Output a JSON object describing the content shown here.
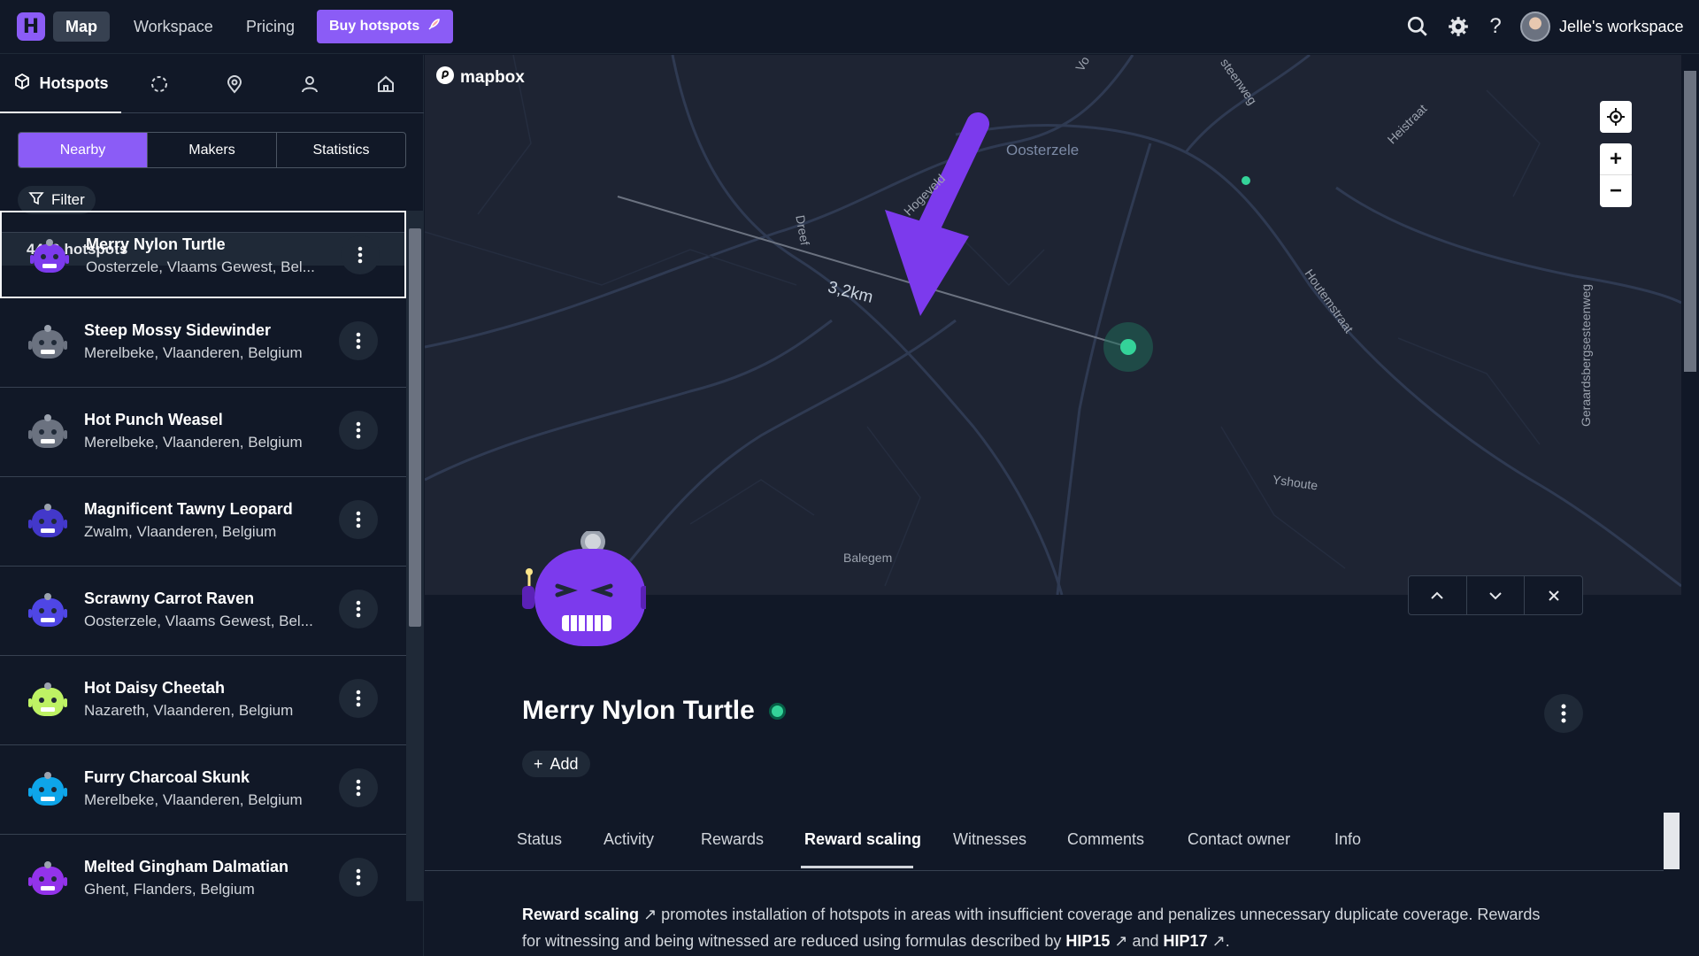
{
  "topbar": {
    "logo_letter": "H",
    "nav": [
      "Map",
      "Workspace",
      "Pricing"
    ],
    "buy_label": "Buy hotspots",
    "workspace_label": "Jelle's workspace",
    "icons": [
      "search-icon",
      "gear-icon",
      "help-icon"
    ]
  },
  "sidebar": {
    "active_tab_label": "Hotspots",
    "tab_icons": [
      "cube-icon",
      "region-icon",
      "location-pin-icon",
      "user-icon",
      "home-icon"
    ],
    "segments": [
      "Nearby",
      "Makers",
      "Statistics"
    ],
    "selected_segment": "Nearby",
    "filter_label": "Filter",
    "count_label": "4490 hotspots",
    "items": [
      {
        "name": "Merry Nylon Turtle",
        "location": "Oosterzele, Vlaams Gewest, Bel...",
        "color": "#7c3aed"
      },
      {
        "name": "Steep Mossy Sidewinder",
        "location": "Merelbeke, Vlaanderen, Belgium",
        "color": "#6b7280"
      },
      {
        "name": "Hot Punch Weasel",
        "location": "Merelbeke, Vlaanderen, Belgium",
        "color": "#6b7280"
      },
      {
        "name": "Magnificent Tawny Leopard",
        "location": "Zwalm, Vlaanderen, Belgium",
        "color": "#4338ca"
      },
      {
        "name": "Scrawny Carrot Raven",
        "location": "Oosterzele, Vlaams Gewest, Bel...",
        "color": "#4f46e5"
      },
      {
        "name": "Hot Daisy Cheetah",
        "location": "Nazareth, Vlaanderen, Belgium",
        "color": "#bef264"
      },
      {
        "name": "Furry Charcoal Skunk",
        "location": "Merelbeke, Vlaanderen, Belgium",
        "color": "#0ea5e9"
      },
      {
        "name": "Melted Gingham Dalmatian",
        "location": "Ghent, Flanders, Belgium",
        "color": "#9333ea"
      }
    ]
  },
  "map": {
    "attribution": "mapbox",
    "distance_label": "3,2km",
    "places": [
      "Oosterzele",
      "Balegem",
      "Yshoute",
      "Houtemstraat",
      "Geraardsbergsesteenweg",
      "Dreef",
      "Hogeveld",
      "Heistraat",
      "steenweg",
      "Vo"
    ],
    "controls": [
      "locate-icon",
      "zoom-in-icon",
      "zoom-out-icon"
    ]
  },
  "detail": {
    "title": "Merry Nylon Turtle",
    "add_label": "Add",
    "tabs": [
      "Status",
      "Activity",
      "Rewards",
      "Reward scaling",
      "Witnesses",
      "Comments",
      "Contact owner",
      "Info"
    ],
    "active_tab": "Reward scaling",
    "desc_link1": "Reward scaling",
    "desc_text1": " promotes installation of hotspots in areas with insufficient coverage and penalizes unnecessary duplicate coverage. Rewards for witnessing and being witnessed are reduced using formulas described by ",
    "desc_link2": "HIP15",
    "desc_text2": " and ",
    "desc_link3": "HIP17",
    "desc_text3": "."
  },
  "colors": {
    "accent": "#8b5cf6",
    "online": "#34d399",
    "background": "#111827"
  }
}
